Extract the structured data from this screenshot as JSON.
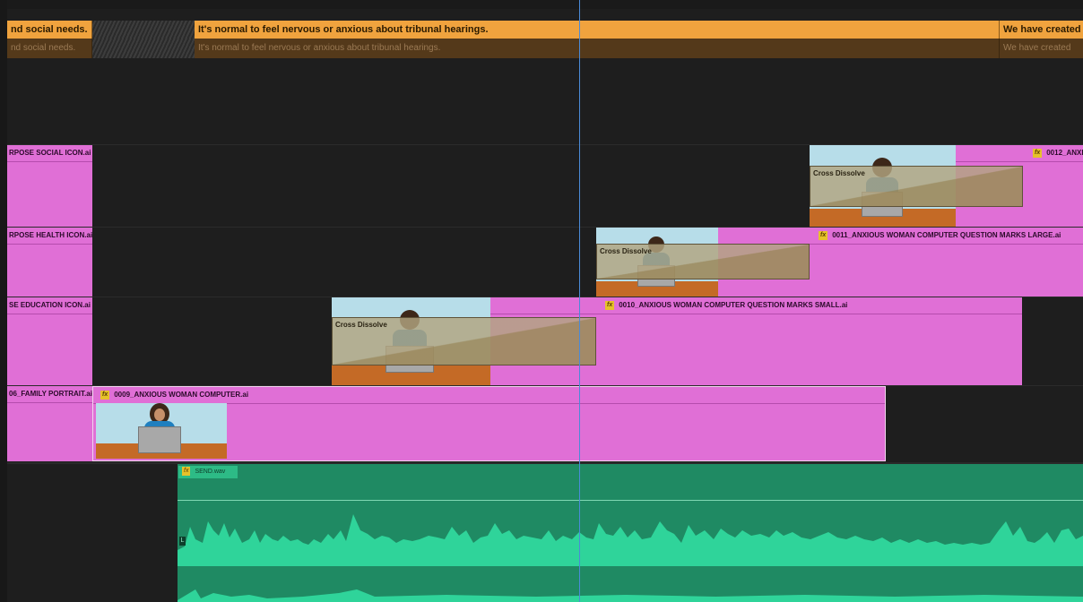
{
  "captions": {
    "top_left": "nd social needs.",
    "top_middle": "It's normal to feel nervous or anxious about tribunal hearings.",
    "top_right": "We have created",
    "bottom_left": "nd social needs.",
    "bottom_middle": "It's normal to feel nervous or anxious  about tribunal hearings.",
    "bottom_right": "We have created"
  },
  "tracks": {
    "v4": {
      "left_clip": "RPOSE SOCIAL ICON.ai",
      "right_clip": "0012_ANXI",
      "transition": "Cross Dissolve"
    },
    "v3": {
      "left_clip": "RPOSE HEALTH ICON.ai",
      "right_clip": "0011_ANXIOUS WOMAN COMPUTER QUESTION MARKS LARGE.ai",
      "transition": "Cross Dissolve"
    },
    "v2": {
      "left_clip": "SE EDUCATION ICON.ai",
      "right_clip": "0010_ANXIOUS WOMAN COMPUTER QUESTION MARKS SMALL.ai",
      "transition": "Cross Dissolve"
    },
    "v1": {
      "left_clip": "06_FAMILY PORTRAIT.ai",
      "right_clip": "0009_ANXIOUS WOMAN COMPUTER.ai"
    }
  },
  "fx_badge": "fx",
  "audio": {
    "clip_name": "SEND.wav",
    "channel_label": "L"
  },
  "colors": {
    "caption": "#f0a33e",
    "video_clip": "#e06fd6",
    "audio_clip": "#1f8a63",
    "waveform": "#2fd49a",
    "playhead": "#4a8ad8"
  }
}
